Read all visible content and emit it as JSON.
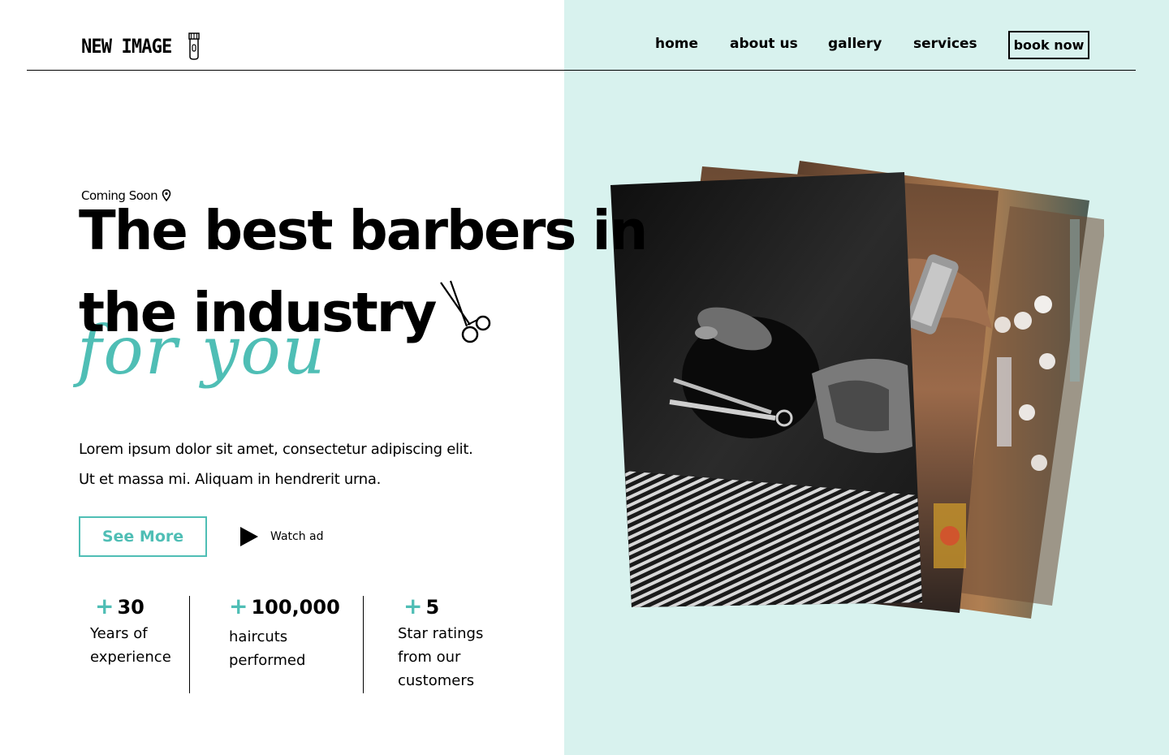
{
  "header": {
    "logo_text": "NEW IMAGE",
    "nav": [
      "home",
      "about us",
      "gallery",
      "services"
    ],
    "cta": "book now"
  },
  "hero": {
    "tag": "Coming Soon",
    "headline_line1": "The best barbers in",
    "headline_line2": "the industry",
    "script_text": "for you",
    "lead_line1": "Lorem ipsum dolor sit amet, consectetur adipiscing elit.",
    "lead_line2": "Ut et massa mi. Aliquam in hendrerit urna.",
    "primary_button": "See More",
    "secondary_button": "Watch ad"
  },
  "stats": [
    {
      "value": "30",
      "line1": "Years of",
      "line2": "experience",
      "line3": ""
    },
    {
      "value": "100,000",
      "line1": "haircuts",
      "line2": "performed",
      "line3": ""
    },
    {
      "value": "5",
      "line1": "Star ratings",
      "line2": "from our",
      "line3": "customers"
    }
  ],
  "colors": {
    "accent": "#4fbeb5",
    "panel": "#d8f2ee",
    "text": "#000000"
  },
  "icons": [
    "razor-icon",
    "location-pin-icon",
    "scissors-icon",
    "play-icon"
  ]
}
